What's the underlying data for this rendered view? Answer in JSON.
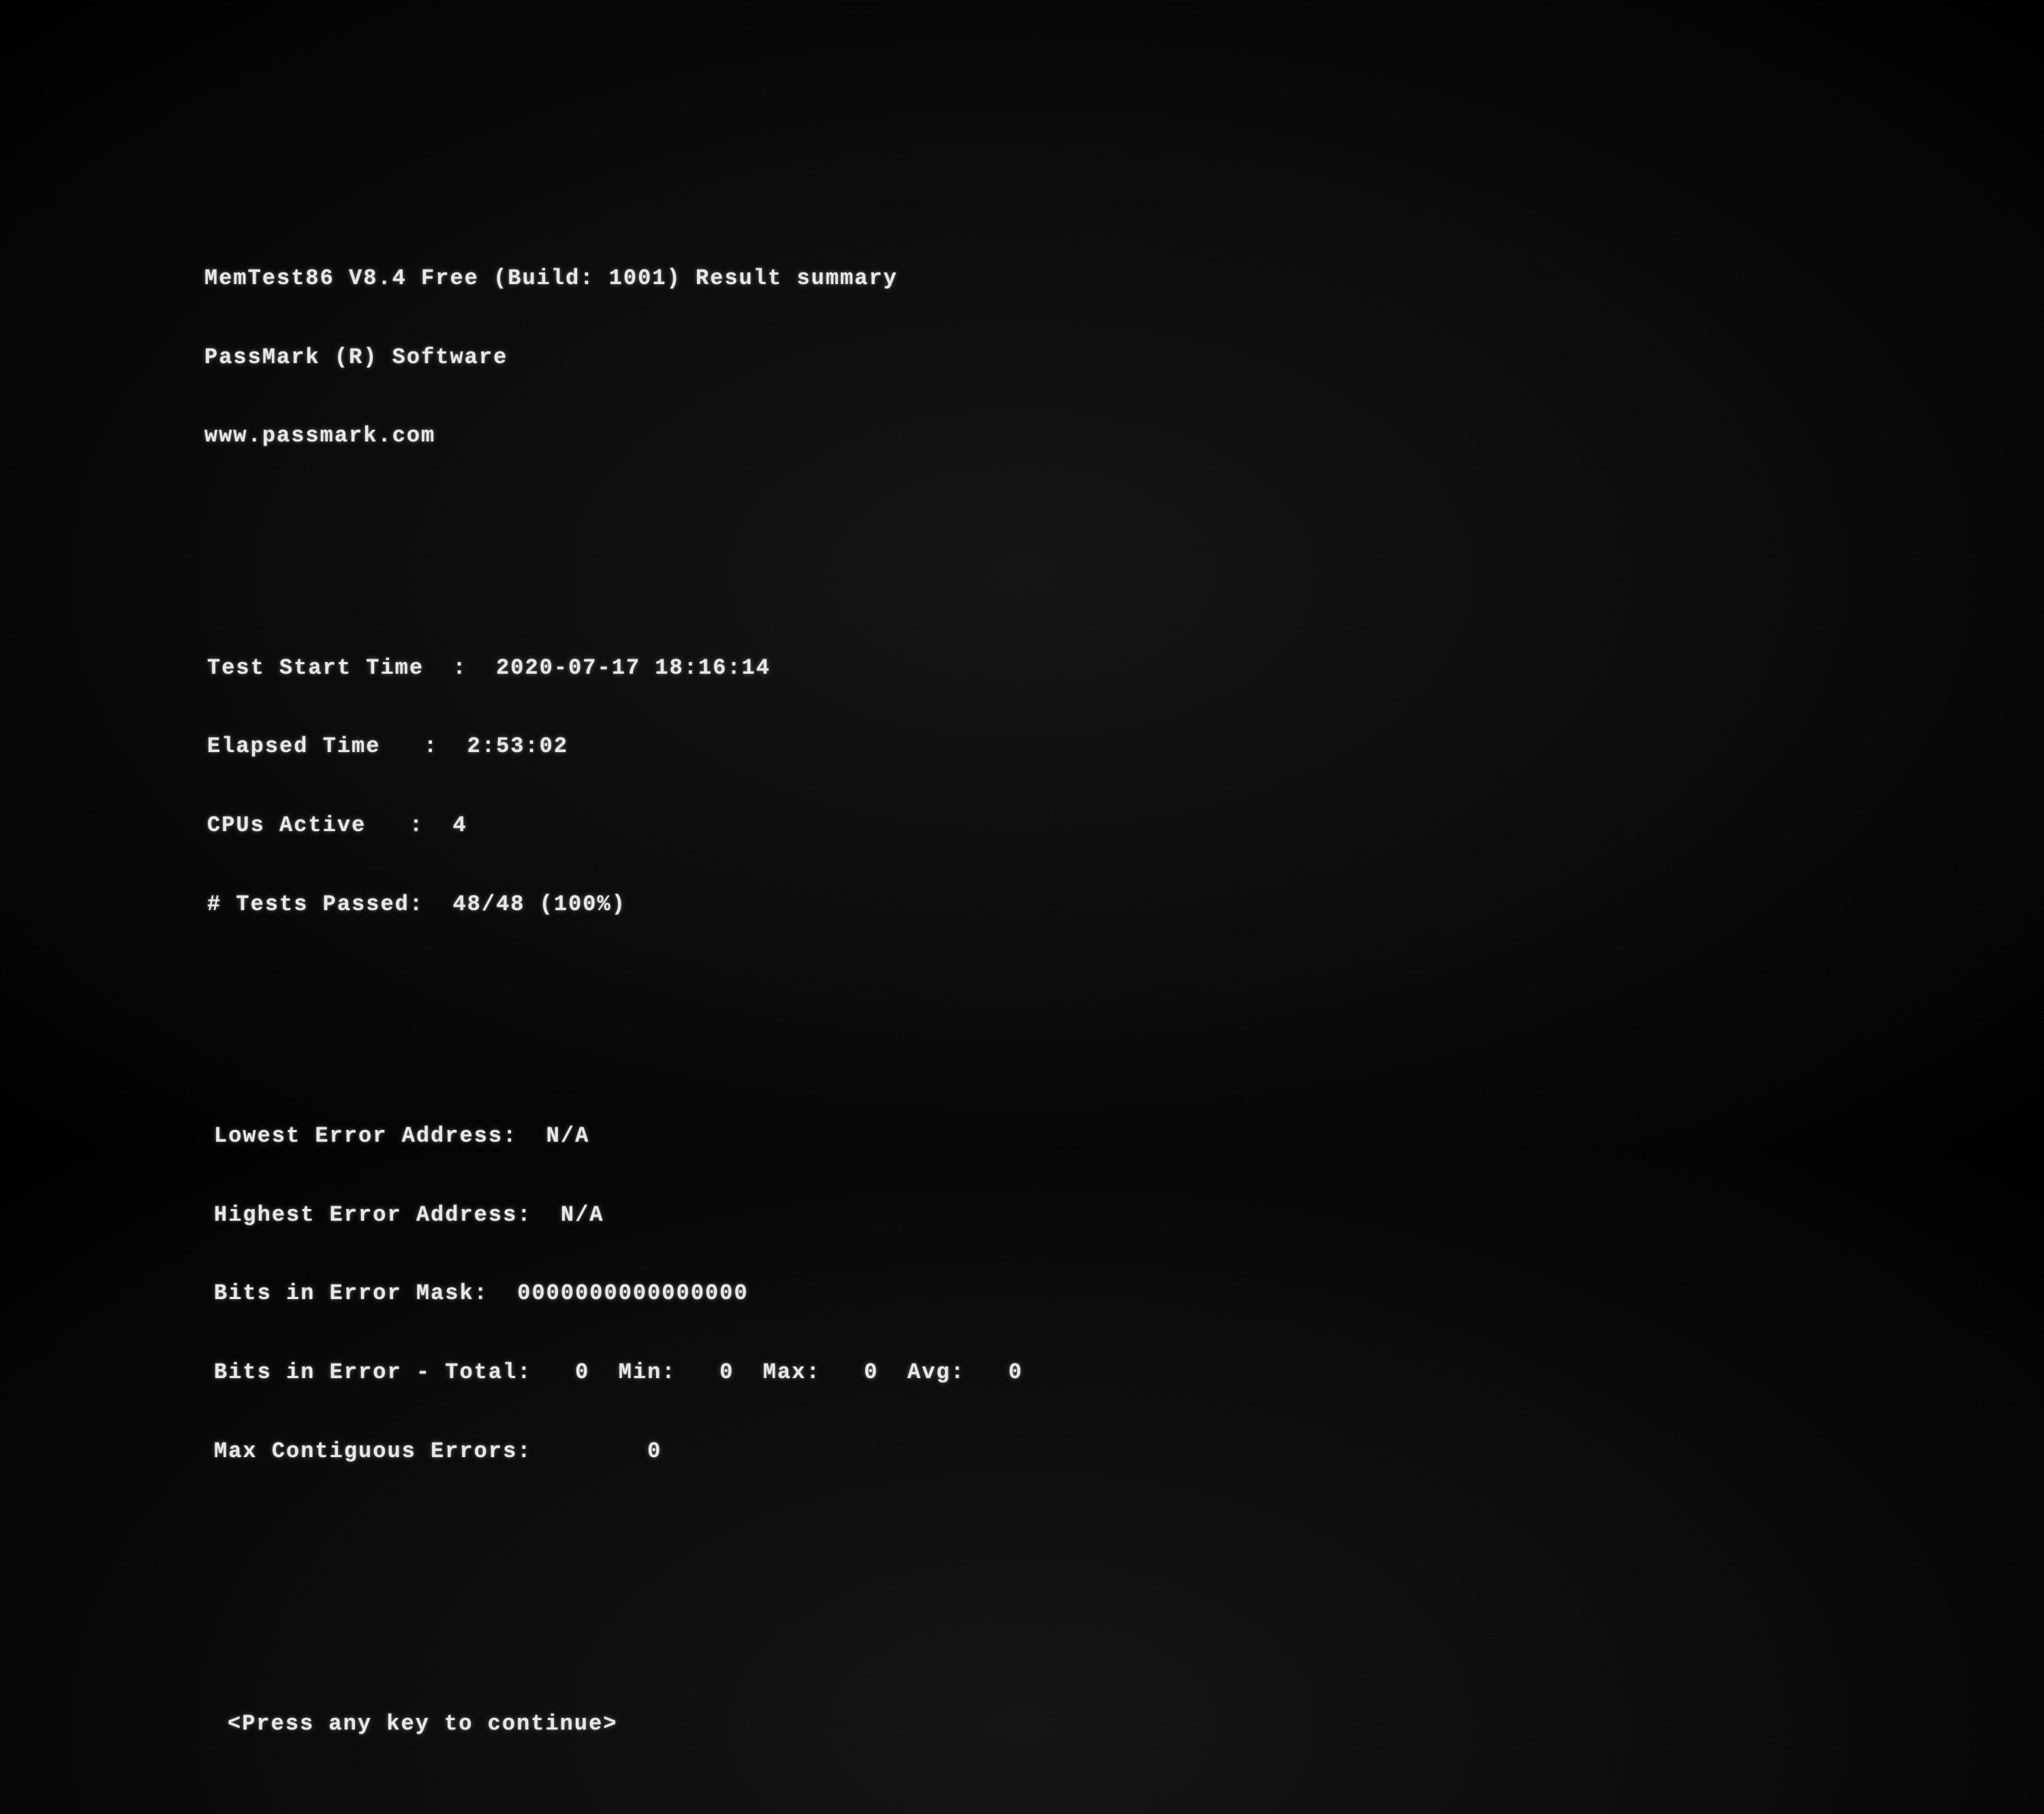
{
  "header": {
    "title_line": "MemTest86 V8.4 Free (Build: 1001) Result summary",
    "vendor": "PassMark (R) Software",
    "url": "www.passmark.com"
  },
  "test": {
    "start_label": "Test Start Time  :  ",
    "start_value": "2020-07-17 18:16:14",
    "elapsed_label": "Elapsed Time   :  ",
    "elapsed_value": "2:53:02",
    "cpus_label": "CPUs Active   :  ",
    "cpus_value": "4",
    "passed_label": "# Tests Passed:  ",
    "passed_value": "48/48 (100%)"
  },
  "errors": {
    "lowest_label": "Lowest Error Address:  ",
    "lowest_value": "N/A",
    "highest_label": "Highest Error Address:  ",
    "highest_value": "N/A",
    "mask_label": "Bits in Error Mask:  ",
    "mask_value": "0000000000000000",
    "bits_total_label": "Bits in Error - Total:   ",
    "bits_total_value": "0",
    "bits_min_label": "  Min:   ",
    "bits_min_value": "0",
    "bits_max_label": "  Max:   ",
    "bits_max_value": "0",
    "bits_avg_label": "  Avg:   ",
    "bits_avg_value": "0",
    "contig_label": "Max Contiguous Errors:        ",
    "contig_value": "0"
  },
  "prompt": {
    "text": "<Press any key to continue>"
  }
}
